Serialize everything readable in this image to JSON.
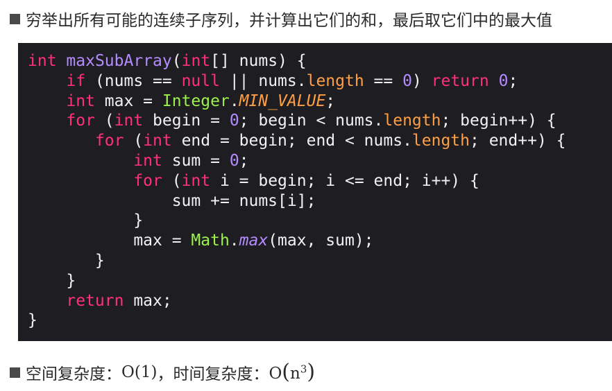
{
  "heading": {
    "text": "穷举出所有可能的连续子序列，并计算出它们的和，最后取它们中的最大值"
  },
  "complexity": {
    "space_label": "空间复杂度：",
    "space_value": "O(1)",
    "separator": "，",
    "time_label": "时间复杂度：",
    "time_value_prefix": "O",
    "time_value_open": "(",
    "time_value_base": "n",
    "time_value_exp": "3",
    "time_value_close": ")"
  },
  "code": {
    "language": "java",
    "lines": [
      [
        [
          "type",
          "int"
        ],
        [
          "plain",
          " "
        ],
        [
          "method",
          "maxSubArray"
        ],
        [
          "plain",
          "("
        ],
        [
          "type",
          "int"
        ],
        [
          "plain",
          "[] nums) {"
        ]
      ],
      [
        [
          "plain",
          "    "
        ],
        [
          "keyword",
          "if"
        ],
        [
          "plain",
          " (nums == "
        ],
        [
          "keyword",
          "null"
        ],
        [
          "plain",
          " || nums."
        ],
        [
          "field",
          "length"
        ],
        [
          "plain",
          " == "
        ],
        [
          "number",
          "0"
        ],
        [
          "plain",
          ") "
        ],
        [
          "keyword",
          "return"
        ],
        [
          "plain",
          " "
        ],
        [
          "number",
          "0"
        ],
        [
          "plain",
          ";"
        ]
      ],
      [
        [
          "plain",
          "    "
        ],
        [
          "type",
          "int"
        ],
        [
          "plain",
          " max = "
        ],
        [
          "class",
          "Integer"
        ],
        [
          "plain",
          "."
        ],
        [
          "const",
          "MIN_VALUE"
        ],
        [
          "plain",
          ";"
        ]
      ],
      [
        [
          "plain",
          "    "
        ],
        [
          "keyword",
          "for"
        ],
        [
          "plain",
          " ("
        ],
        [
          "type",
          "int"
        ],
        [
          "plain",
          " begin = "
        ],
        [
          "number",
          "0"
        ],
        [
          "plain",
          "; begin < nums."
        ],
        [
          "field",
          "length"
        ],
        [
          "plain",
          "; begin++) {"
        ]
      ],
      [
        [
          "plain",
          "       "
        ],
        [
          "keyword",
          "for"
        ],
        [
          "plain",
          " ("
        ],
        [
          "type",
          "int"
        ],
        [
          "plain",
          " end = begin; end < nums."
        ],
        [
          "field",
          "length"
        ],
        [
          "plain",
          "; end++) {"
        ]
      ],
      [
        [
          "plain",
          "           "
        ],
        [
          "type",
          "int"
        ],
        [
          "plain",
          " sum = "
        ],
        [
          "number",
          "0"
        ],
        [
          "plain",
          ";"
        ]
      ],
      [
        [
          "plain",
          "           "
        ],
        [
          "keyword",
          "for"
        ],
        [
          "plain",
          " ("
        ],
        [
          "type",
          "int"
        ],
        [
          "plain",
          " i = begin; i <= end; i++) {"
        ]
      ],
      [
        [
          "plain",
          "               sum += nums[i];"
        ]
      ],
      [
        [
          "plain",
          "           }"
        ]
      ],
      [
        [
          "plain",
          "           max = "
        ],
        [
          "class",
          "Math"
        ],
        [
          "plain",
          "."
        ],
        [
          "italic-method",
          "max"
        ],
        [
          "plain",
          "(max, sum);"
        ]
      ],
      [
        [
          "plain",
          "       }"
        ]
      ],
      [
        [
          "plain",
          "    }"
        ]
      ],
      [
        [
          "plain",
          "    "
        ],
        [
          "keyword",
          "return"
        ],
        [
          "plain",
          " max;"
        ]
      ],
      [
        [
          "plain",
          "}"
        ]
      ]
    ]
  },
  "colors": {
    "code_background": "#1e1e22",
    "keyword": "#ff2f7d",
    "method": "#b58cff",
    "number": "#b58cff",
    "field": "#ff9f45",
    "class": "#9cf24a",
    "plain": "#f2f2f2",
    "bullet": "#4a4a4a"
  }
}
